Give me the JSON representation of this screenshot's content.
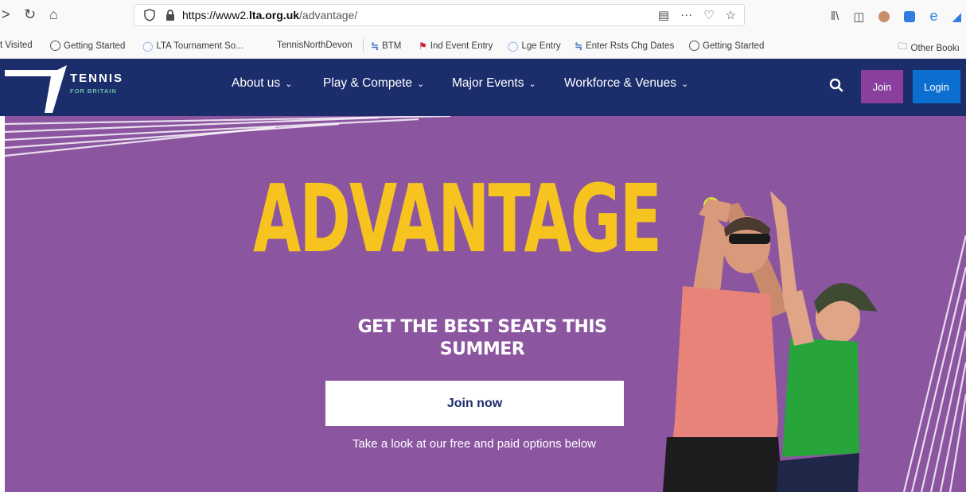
{
  "browser": {
    "url_prefix": "https://www2.",
    "url_domain": "lta.org.uk",
    "url_path": "/advantage/",
    "bookmarks": [
      {
        "label": "t Visited"
      },
      {
        "label": "Getting Started"
      },
      {
        "label": "LTA Tournament So..."
      },
      {
        "label": "TennisNorthDevon"
      },
      {
        "label": "BTM"
      },
      {
        "label": "Ind Event Entry"
      },
      {
        "label": "Lge Entry"
      },
      {
        "label": "Enter Rsts Chg Dates"
      },
      {
        "label": "Getting Started"
      },
      {
        "label": "Other Bookı"
      }
    ]
  },
  "header": {
    "logo_text": "TENNIS",
    "logo_sub": "FOR BRITAIN",
    "logo_mark": "LTA",
    "nav": [
      {
        "label": "About us"
      },
      {
        "label": "Play & Compete"
      },
      {
        "label": "Major Events"
      },
      {
        "label": "Workforce & Venues"
      }
    ],
    "join_label": "Join",
    "login_label": "Login"
  },
  "hero": {
    "headline": "ADVANTAGE",
    "subhead": "GET THE BEST SEATS THIS SUMMER",
    "cta_label": "Join now",
    "tagline": "Take a look at our free and paid options below"
  },
  "colors": {
    "header_bg": "#1b2d6b",
    "hero_bg": "#8b55a0",
    "headline": "#f7c31f",
    "join": "#8a3f9e",
    "login": "#0a6fcf"
  }
}
